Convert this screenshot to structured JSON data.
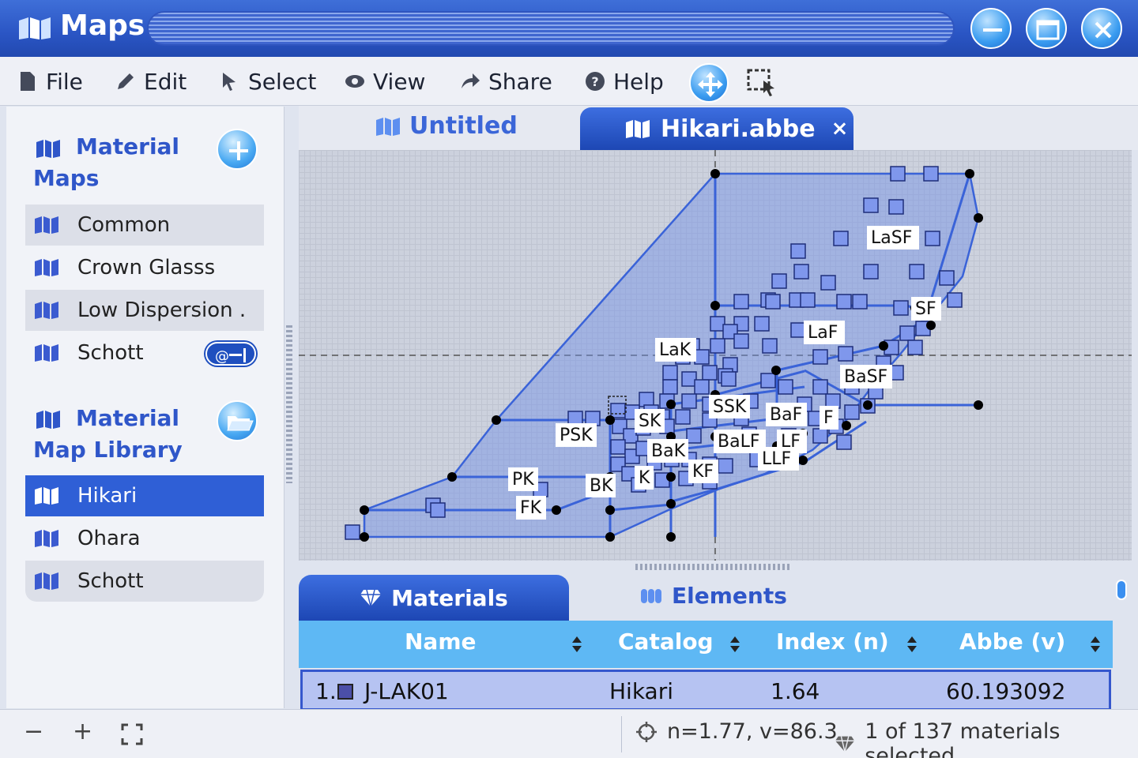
{
  "window": {
    "title": "Maps"
  },
  "menu": {
    "file": "File",
    "edit": "Edit",
    "select": "Select",
    "view": "View",
    "share": "Share",
    "help": "Help"
  },
  "sidebar": {
    "section1_title_line1": "Material",
    "section1_title_line2": "Maps",
    "maps": [
      {
        "label": "Common"
      },
      {
        "label": "Crown Glasss"
      },
      {
        "label": "Low Dispersion ."
      },
      {
        "label": "Schott"
      }
    ],
    "section2_title_line1": "Material",
    "section2_title_line2": "Map Library",
    "library": [
      {
        "label": "Hikari"
      },
      {
        "label": "Ohara"
      },
      {
        "label": "Schott"
      }
    ]
  },
  "tabs": {
    "untitled": "Untitled",
    "active": "Hikari.abbe",
    "close": "×"
  },
  "plot": {
    "region_labels": [
      "LaSF",
      "SF",
      "LaF",
      "LaK",
      "BaSF",
      "SSK",
      "BaF",
      "F",
      "PSK",
      "SK",
      "BaLF",
      "LF",
      "BaK",
      "LLF",
      "KF",
      "PK",
      "K",
      "BK",
      "FK"
    ],
    "colors": {
      "region_fill": "#6e8fe6",
      "region_stroke": "#3a63d8",
      "marker_fill": "#7f97ec",
      "node": "#000000"
    }
  },
  "bottom_tabs": {
    "materials": "Materials",
    "elements": "Elements"
  },
  "table": {
    "columns": [
      "Name",
      "Catalog",
      "Index (n)",
      "Abbe (v)"
    ],
    "rows": [
      {
        "num": "1.",
        "name": "J-LAK01",
        "catalog": "Hikari",
        "index": "1.64",
        "abbe": "60.193092"
      }
    ]
  },
  "status": {
    "zoom_out": "−",
    "zoom_in": "+",
    "coords": "n=1.77, v=86.3",
    "selection": "1 of 137 materials selected"
  }
}
